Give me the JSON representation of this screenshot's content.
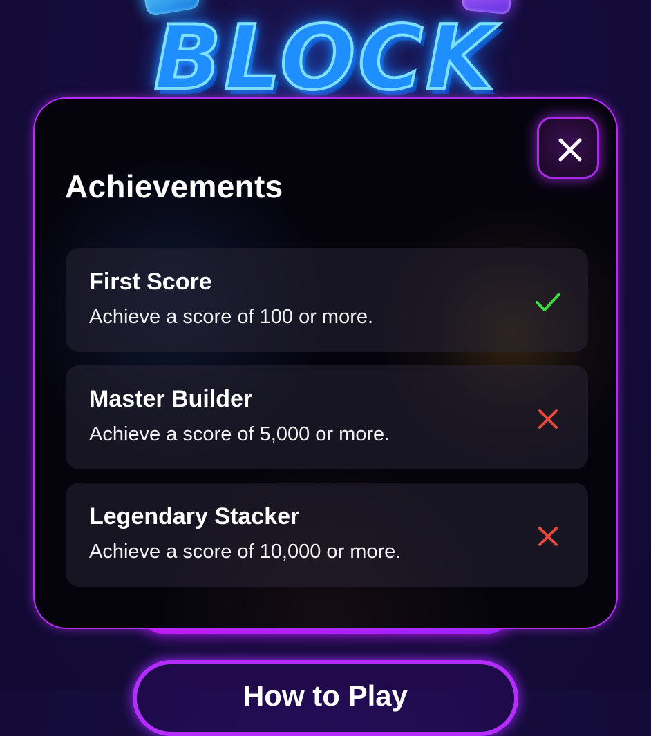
{
  "background": {
    "logo_text": "BLOCK",
    "secondary_button_label": "How to Play"
  },
  "modal": {
    "title": "Achievements",
    "close_icon": "close-icon",
    "achievements": [
      {
        "name": "First Score",
        "description": "Achieve a score of 100 or more.",
        "unlocked": true,
        "status_icon": "check-icon",
        "status_color": "#3ddc3d"
      },
      {
        "name": "Master Builder",
        "description": "Achieve a score of 5,000 or more.",
        "unlocked": false,
        "status_icon": "cross-icon",
        "status_color": "#e8473c"
      },
      {
        "name": "Legendary Stacker",
        "description": "Achieve a score of 10,000 or more.",
        "unlocked": false,
        "status_icon": "cross-icon",
        "status_color": "#e8473c"
      }
    ]
  },
  "colors": {
    "background": "#150c3c",
    "modal_border": "#b42df5",
    "modal_background": "#05040d",
    "logo_blue": "#1f8fff",
    "button_purple": "#b52cff"
  }
}
